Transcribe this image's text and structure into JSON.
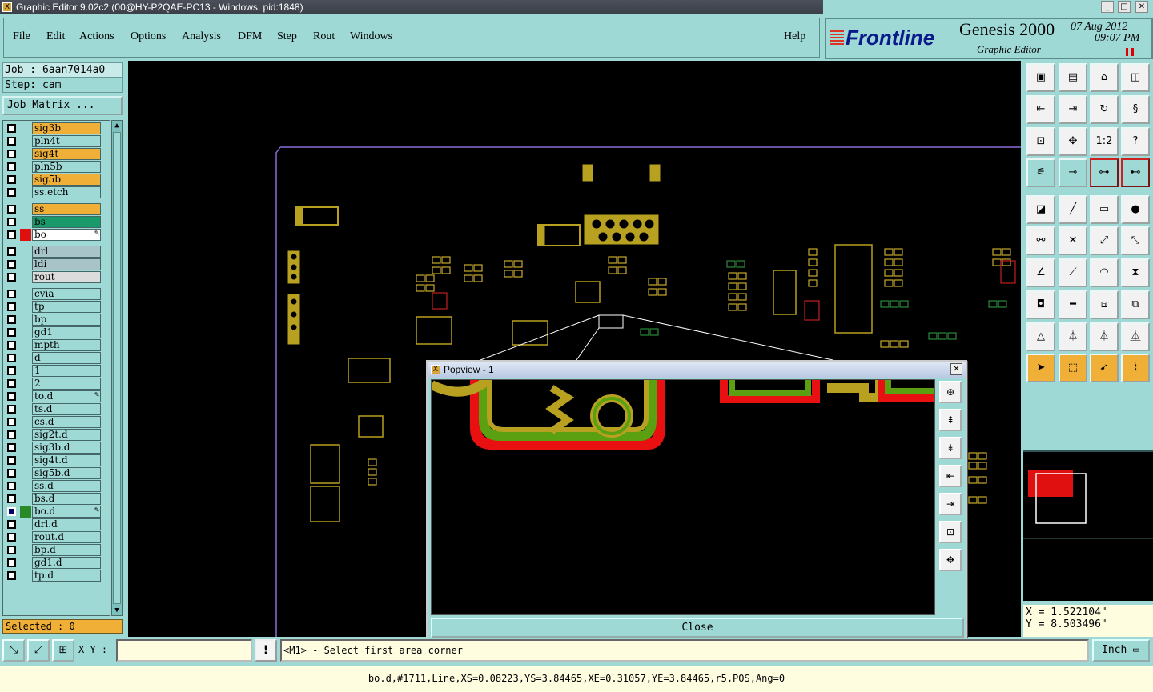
{
  "window": {
    "title": "Graphic Editor 9.02c2 (00@HY-P2QAE-PC13 - Windows, pid:1848)"
  },
  "menu": {
    "items": [
      "File",
      "Edit",
      "Actions",
      "Options",
      "Analysis",
      "DFM",
      "Step",
      "Rout",
      "Windows"
    ],
    "help": "Help"
  },
  "brand": {
    "logo": "Frontline",
    "product": "Genesis 2000",
    "subtitle": "Graphic Editor",
    "date": "07 Aug 2012",
    "time": "09:07 PM"
  },
  "job": {
    "job_label": "Job : 6aan7014a0",
    "step_label": "Step: cam",
    "matrix_button": "Job Matrix ..."
  },
  "layers": [
    {
      "name": "sig3b",
      "color": "#f0b038",
      "swatch": ""
    },
    {
      "name": "pln4t",
      "color": "#9fd9d6",
      "swatch": ""
    },
    {
      "name": "sig4t",
      "color": "#f0b038",
      "swatch": ""
    },
    {
      "name": "pln5b",
      "color": "#9fd9d6",
      "swatch": ""
    },
    {
      "name": "sig5b",
      "color": "#f0b038",
      "swatch": ""
    },
    {
      "name": "ss.etch",
      "color": "#9fd9d6",
      "swatch": ""
    },
    {
      "name": "ss",
      "color": "#f0b038",
      "swatch": ""
    },
    {
      "name": "bs",
      "color": "#1a9a6a",
      "swatch": ""
    },
    {
      "name": "bo",
      "color": "#ffffff",
      "swatch": "#e01010",
      "pen": true
    },
    {
      "name": "drl",
      "color": "#a8c4c8",
      "swatch": ""
    },
    {
      "name": "ldi",
      "color": "#a8c4c8",
      "swatch": ""
    },
    {
      "name": "rout",
      "color": "#dcdcdc",
      "swatch": ""
    },
    {
      "name": "cvia",
      "color": "#9fd9d6",
      "swatch": ""
    },
    {
      "name": "tp",
      "color": "#9fd9d6",
      "swatch": ""
    },
    {
      "name": "bp",
      "color": "#9fd9d6",
      "swatch": ""
    },
    {
      "name": "gd1",
      "color": "#9fd9d6",
      "swatch": ""
    },
    {
      "name": "mpth",
      "color": "#9fd9d6",
      "swatch": ""
    },
    {
      "name": "d",
      "color": "#9fd9d6",
      "swatch": ""
    },
    {
      "name": "1",
      "color": "#9fd9d6",
      "swatch": ""
    },
    {
      "name": "2",
      "color": "#9fd9d6",
      "swatch": ""
    },
    {
      "name": "to.d",
      "color": "#9fd9d6",
      "swatch": "",
      "pen": true
    },
    {
      "name": "ts.d",
      "color": "#9fd9d6",
      "swatch": ""
    },
    {
      "name": "cs.d",
      "color": "#9fd9d6",
      "swatch": ""
    },
    {
      "name": "sig2t.d",
      "color": "#9fd9d6",
      "swatch": ""
    },
    {
      "name": "sig3b.d",
      "color": "#9fd9d6",
      "swatch": ""
    },
    {
      "name": "sig4t.d",
      "color": "#9fd9d6",
      "swatch": ""
    },
    {
      "name": "sig5b.d",
      "color": "#9fd9d6",
      "swatch": ""
    },
    {
      "name": "ss.d",
      "color": "#9fd9d6",
      "swatch": ""
    },
    {
      "name": "bs.d",
      "color": "#9fd9d6",
      "swatch": ""
    },
    {
      "name": "bo.d",
      "color": "#9fd9d6",
      "swatch": "#2a8a2a",
      "pen": true,
      "selected": true
    },
    {
      "name": "drl.d",
      "color": "#9fd9d6",
      "swatch": ""
    },
    {
      "name": "rout.d",
      "color": "#9fd9d6",
      "swatch": ""
    },
    {
      "name": "bp.d",
      "color": "#9fd9d6",
      "swatch": ""
    },
    {
      "name": "gd1.d",
      "color": "#9fd9d6",
      "swatch": ""
    },
    {
      "name": "tp.d",
      "color": "#9fd9d6",
      "swatch": ""
    }
  ],
  "selected": "Selected : 0",
  "toolbar_labels": {
    "ratio": "1:2",
    "help": "?"
  },
  "popup": {
    "title": "Popview - 1",
    "close_label": "Close"
  },
  "coords": {
    "x": "X = 1.522104\"",
    "y": "Y = 8.503496\""
  },
  "bottom": {
    "xy_label": "X Y :",
    "xy_value": "",
    "message": "<M1> - Select first area corner",
    "unit": "Inch"
  },
  "status": "bo.d,#1711,Line,XS=0.08223,YS=3.84465,XE=0.31057,YE=3.84465,r5,POS,Ang=0",
  "colors": {
    "accent": "#9fd9d6",
    "highlight": "#f0b038",
    "copper": "#b8a020",
    "green": "#5aa010",
    "red": "#e81010"
  }
}
